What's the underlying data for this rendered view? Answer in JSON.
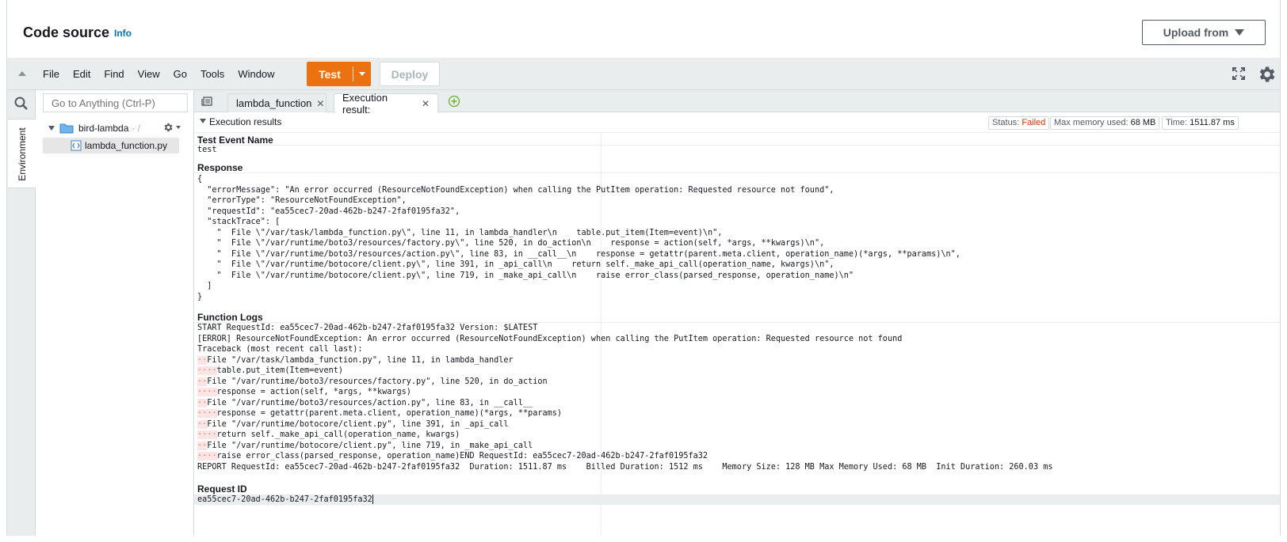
{
  "header": {
    "title": "Code source",
    "info_link": "Info",
    "upload_label": "Upload from"
  },
  "toolbar": {
    "menu": [
      "File",
      "Edit",
      "Find",
      "View",
      "Go",
      "Tools",
      "Window"
    ],
    "test_label": "Test",
    "deploy_label": "Deploy"
  },
  "sidebar": {
    "rail_tab": "Environment",
    "goto_placeholder": "Go to Anything (Ctrl-P)",
    "folder_name": "bird-lambda",
    "folder_suffix": "- /",
    "file_name": "lambda_function.py"
  },
  "tabs": [
    {
      "label": "lambda_function"
    },
    {
      "label": "Execution result:"
    }
  ],
  "results": {
    "header_title": "Execution results",
    "status_label": "Status:",
    "status_value": "Failed",
    "memory_label": "Max memory used:",
    "memory_value": "68 MB",
    "time_label": "Time:",
    "time_value": "1511.87 ms",
    "test_event_title": "Test Event Name",
    "test_event_value": "test",
    "response_title": "Response",
    "response_lines": [
      "{",
      "  \"errorMessage\": \"An error occurred (ResourceNotFoundException) when calling the PutItem operation: Requested resource not found\",",
      "  \"errorType\": \"ResourceNotFoundException\",",
      "  \"requestId\": \"ea55cec7-20ad-462b-b247-2faf0195fa32\",",
      "  \"stackTrace\": [",
      "    \"  File \\\"/var/task/lambda_function.py\\\", line 11, in lambda_handler\\n    table.put_item(Item=event)\\n\",",
      "    \"  File \\\"/var/runtime/boto3/resources/factory.py\\\", line 520, in do_action\\n    response = action(self, *args, **kwargs)\\n\",",
      "    \"  File \\\"/var/runtime/boto3/resources/action.py\\\", line 83, in __call__\\n    response = getattr(parent.meta.client, operation_name)(*args, **params)\\n\",",
      "    \"  File \\\"/var/runtime/botocore/client.py\\\", line 391, in _api_call\\n    return self._make_api_call(operation_name, kwargs)\\n\",",
      "    \"  File \\\"/var/runtime/botocore/client.py\\\", line 719, in _make_api_call\\n    raise error_class(parsed_response, operation_name)\\n\"",
      "  ]",
      "}"
    ],
    "logs_title": "Function Logs",
    "log_lines": [
      {
        "dots": "",
        "text": "START RequestId: ea55cec7-20ad-462b-b247-2faf0195fa32 Version: $LATEST"
      },
      {
        "dots": "",
        "text": "[ERROR] ResourceNotFoundException: An error occurred (ResourceNotFoundException) when calling the PutItem operation: Requested resource not found"
      },
      {
        "dots": "",
        "text": "Traceback (most recent call last):"
      },
      {
        "dots": "··",
        "text": "File \"/var/task/lambda_function.py\", line 11, in lambda_handler"
      },
      {
        "dots": "····",
        "text": "table.put_item(Item=event)"
      },
      {
        "dots": "··",
        "text": "File \"/var/runtime/boto3/resources/factory.py\", line 520, in do_action"
      },
      {
        "dots": "····",
        "text": "response = action(self, *args, **kwargs)"
      },
      {
        "dots": "··",
        "text": "File \"/var/runtime/boto3/resources/action.py\", line 83, in __call__"
      },
      {
        "dots": "····",
        "text": "response = getattr(parent.meta.client, operation_name)(*args, **params)"
      },
      {
        "dots": "··",
        "text": "File \"/var/runtime/botocore/client.py\", line 391, in _api_call"
      },
      {
        "dots": "····",
        "text": "return self._make_api_call(operation_name, kwargs)"
      },
      {
        "dots": "··",
        "text": "File \"/var/runtime/botocore/client.py\", line 719, in _make_api_call"
      },
      {
        "dots": "····",
        "text": "raise error_class(parsed_response, operation_name)END RequestId: ea55cec7-20ad-462b-b247-2faf0195fa32"
      },
      {
        "dots": "",
        "text": "REPORT RequestId: ea55cec7-20ad-462b-b247-2faf0195fa32  Duration: 1511.87 ms    Billed Duration: 1512 ms    Memory Size: 128 MB Max Memory Used: 68 MB  Init Duration: 260.03 ms"
      }
    ],
    "request_id_title": "Request ID",
    "request_id_value": "ea55cec7-20ad-462b-b247-2faf0195fa32"
  },
  "colors": {
    "accent_orange": "#ec7211",
    "status_failed": "#d13212",
    "link_blue": "#0073bb"
  }
}
